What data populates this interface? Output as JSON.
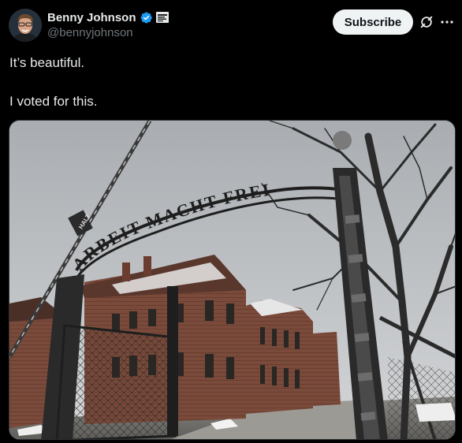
{
  "author": {
    "display_name": "Benny Johnson",
    "handle": "@bennyjohnson",
    "verified": true,
    "verified_color": "#1d9bf0",
    "avatar_icon": "profile-photo",
    "affiliation_icon": "affiliation-badge"
  },
  "actions": {
    "subscribe_label": "Subscribe",
    "grok_icon": "grok-icon",
    "more_icon": "more-icon"
  },
  "post": {
    "text_lines": [
      "It’s beautiful.",
      "I voted for this."
    ]
  },
  "media": {
    "gate_sign_text": "ARBEIT MACHT FREI",
    "sign_plate_text": "HALT"
  },
  "colors": {
    "background": "#000000",
    "text": "#e7e9ea",
    "secondary_text": "#71767b",
    "button_bg": "#eff3f4"
  }
}
